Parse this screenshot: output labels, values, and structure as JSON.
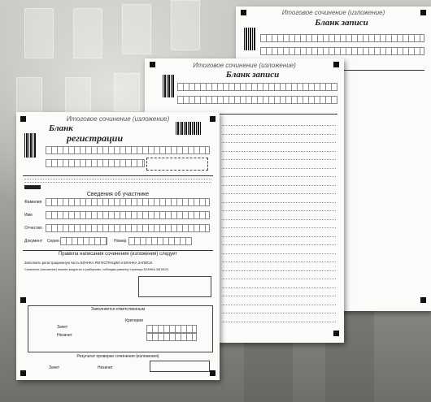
{
  "scene": "Photograph of three Russian final essay exam forms fanned out on a gray background",
  "forms": {
    "back": {
      "header": "Итоговое сочинение (изложение)",
      "subtitle": "Бланк записи"
    },
    "middle": {
      "header": "Итоговое сочинение (изложение)",
      "subtitle": "Бланк записи"
    },
    "front": {
      "header": "Итоговое сочинение (изложение)",
      "subtitle_line1": "Бланк",
      "subtitle_line2": "регистрации",
      "participant_section": "Сведения об участнике",
      "field_surname": "Фамилия",
      "field_name": "Имя",
      "field_patronymic": "Отчество",
      "field_document": "Документ",
      "field_series": "Серия",
      "field_number": "Номер",
      "rules_heading": "Правила написания сочинения (изложения) следует",
      "rule_1": "Заполнить регистрационную часть БЛАНКА РЕГИСТРАЦИИ и БЛАНКА ЗАПИСИ.",
      "rule_2": "Сочинение (изложение) пишите аккуратно и разборчиво, соблюдая разметку страницы БЛАНКА ЗАПИСИ.",
      "assessment_heading": "Заполняется ответственным",
      "result_heading": "Результат проверки сочинения (изложения)",
      "pass_label": "Зачет",
      "fail_label": "Незачет",
      "criteria_label": "Критерии"
    }
  },
  "colors": {
    "background": "#8d8d88",
    "paper": "#fbfbfa",
    "ink": "#222222"
  }
}
